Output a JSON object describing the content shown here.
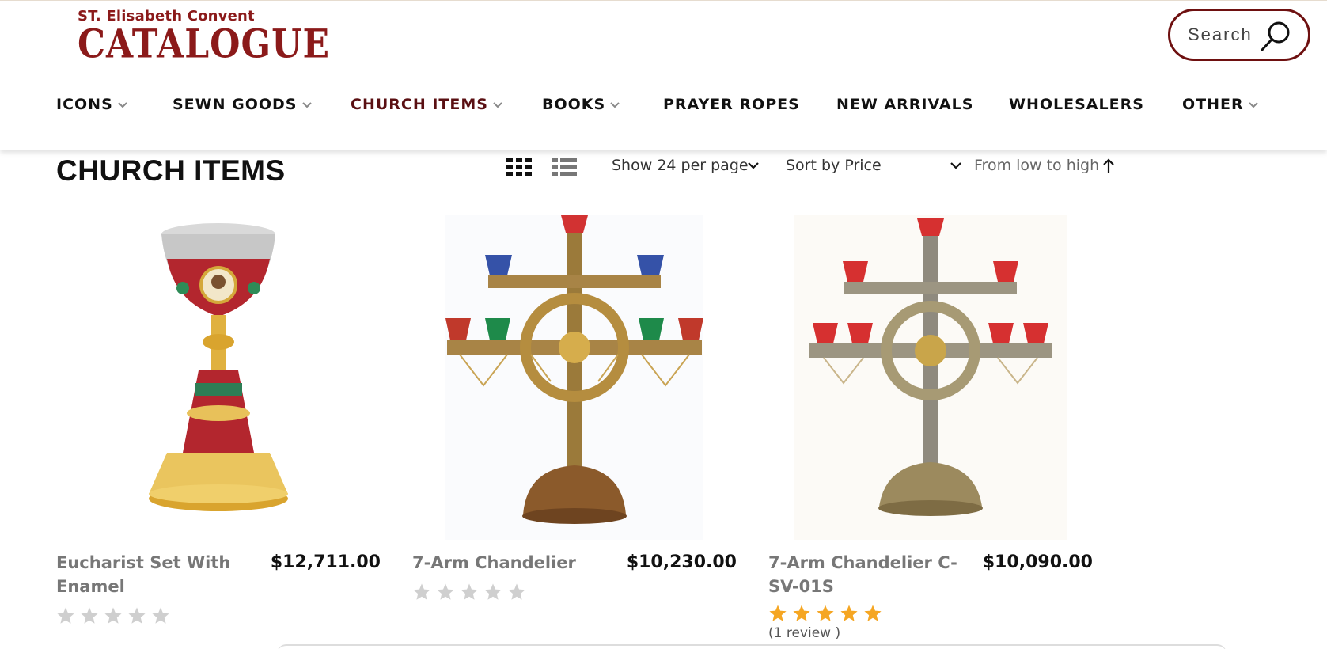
{
  "brand": {
    "tagline": "ST. Elisabeth Convent",
    "name": "CATALOGUE",
    "color": "#8b1a1a"
  },
  "search": {
    "placeholder": "Search",
    "border_color": "#6e1010"
  },
  "nav": {
    "items": [
      {
        "label": "ICONS",
        "has_dropdown": true
      },
      {
        "label": "SEWN GOODS",
        "has_dropdown": true
      },
      {
        "label": "CHURCH ITEMS",
        "has_dropdown": true,
        "active": true
      },
      {
        "label": "BOOKS",
        "has_dropdown": true
      },
      {
        "label": "PRAYER ROPES",
        "has_dropdown": false
      },
      {
        "label": "NEW ARRIVALS",
        "has_dropdown": false
      },
      {
        "label": "WHOLESALERS",
        "has_dropdown": false
      },
      {
        "label": "OTHER",
        "has_dropdown": true
      }
    ],
    "active_color": "#5a0f12"
  },
  "page": {
    "title": "CHURCH ITEMS"
  },
  "toolbar": {
    "view_modes": [
      "grid-view-icon",
      "list-view-icon"
    ],
    "active_view": "grid",
    "per_page": "Show 24 per page",
    "sort_by": "Sort by Price",
    "sort_order": "From low to high"
  },
  "products": [
    {
      "name": "Eucharist Set With Enamel",
      "price": "$12,711.00",
      "rating": 0,
      "review_text": ""
    },
    {
      "name": "7-Arm Chandelier",
      "price": "$10,230.00",
      "rating": 0,
      "review_text": ""
    },
    {
      "name": "7-Arm Chandelier C-SV-01S",
      "price": "$10,090.00",
      "rating": 5,
      "review_text": "(1 review )"
    }
  ],
  "colors": {
    "star_filled": "#f5a623",
    "star_empty": "#cfcfcf",
    "product_name": "#777777"
  }
}
